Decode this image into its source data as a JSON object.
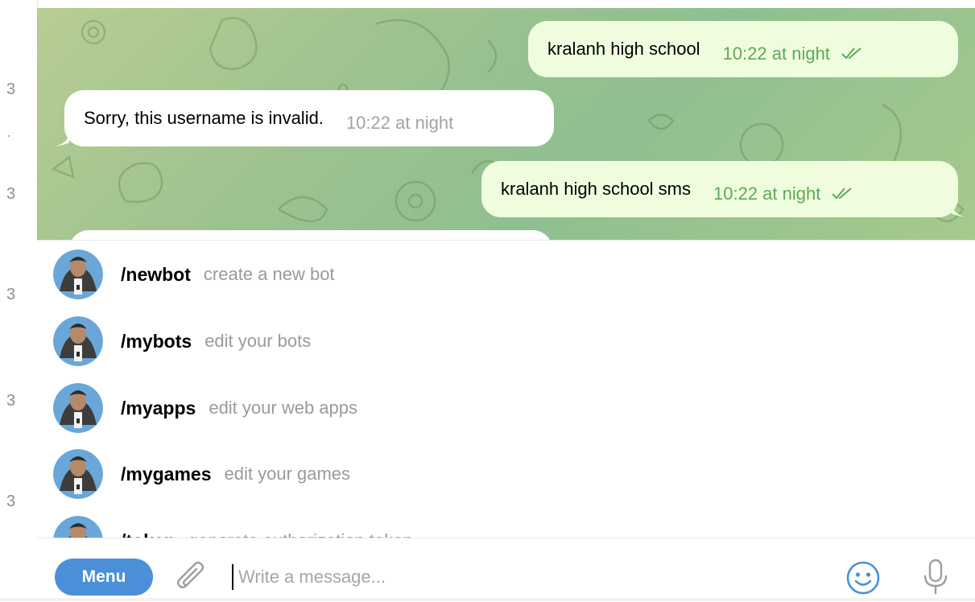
{
  "left_strip": {
    "numbers": [
      "3",
      "3",
      "3",
      "3",
      "3"
    ]
  },
  "messages": [
    {
      "direction": "out",
      "text": "kralanh high school",
      "time": "10:22 at night",
      "read": true
    },
    {
      "direction": "in",
      "text": "Sorry, this username is invalid.",
      "time": "10:22 at night"
    },
    {
      "direction": "out",
      "text": "kralanh high school sms",
      "time": "10:22 at night",
      "read": true
    }
  ],
  "commands": [
    {
      "name": "/newbot",
      "description": "create a new bot"
    },
    {
      "name": "/mybots",
      "description": "edit your bots"
    },
    {
      "name": "/myapps",
      "description": "edit your web apps"
    },
    {
      "name": "/mygames",
      "description": "edit your games"
    },
    {
      "name": "/token",
      "description": "generate authorization token"
    }
  ],
  "input": {
    "menu_label": "Menu",
    "placeholder": "Write a message...",
    "value": ""
  },
  "icons": {
    "attach": "paperclip-icon",
    "emoji": "smiley-icon",
    "mic": "microphone-icon",
    "read_receipt": "double-check-icon",
    "bot_avatar": "bot-avatar"
  },
  "colors": {
    "accent": "#4a90d9",
    "outgoing_bubble": "#effdde",
    "incoming_bubble": "#ffffff",
    "outgoing_time": "#5fa858",
    "incoming_time": "#a0a4a8",
    "chat_bg": "#9dc28f"
  }
}
